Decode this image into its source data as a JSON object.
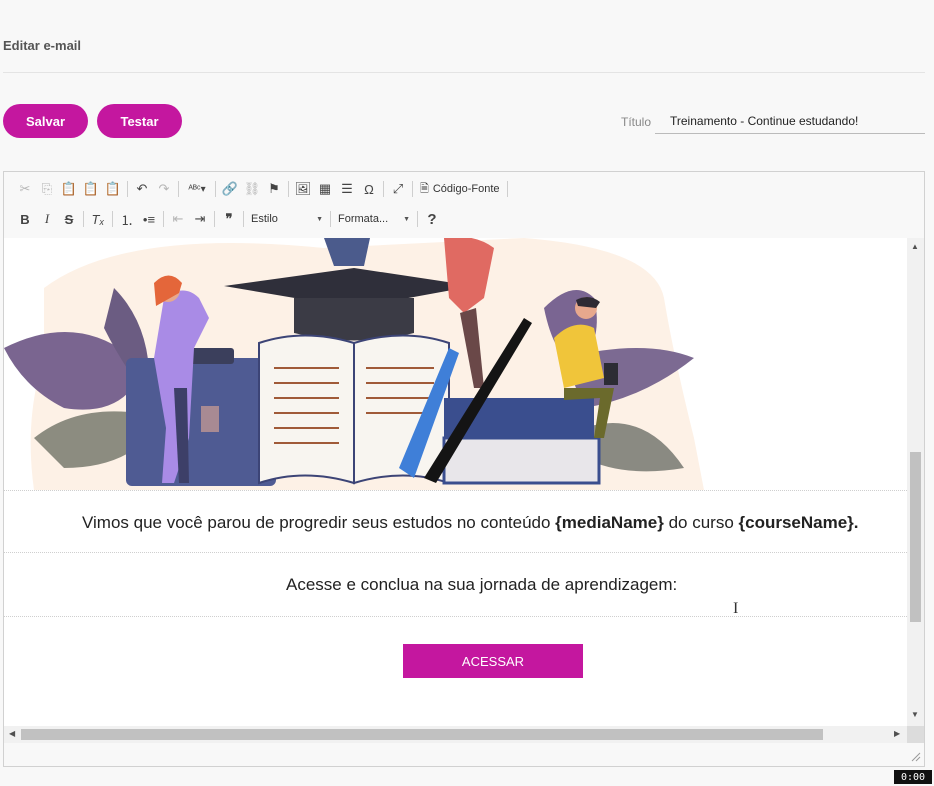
{
  "page": {
    "header": "Editar e-mail"
  },
  "actions": {
    "save_label": "Salvar",
    "test_label": "Testar"
  },
  "title_field": {
    "label": "Título",
    "value": "Treinamento - Continue estudando!"
  },
  "toolbar": {
    "row1": [
      "cut-icon",
      "copy-icon",
      "paste-icon",
      "paste-text-icon",
      "paste-word-icon",
      "undo-icon",
      "redo-icon",
      "spellcheck-icon",
      "link-icon",
      "unlink-icon",
      "anchor-icon",
      "image-icon",
      "table-icon",
      "horizontal-rule-icon",
      "special-char-icon",
      "maximize-icon",
      "source-icon"
    ],
    "source_label": "Código-Fonte",
    "style_combo": "Estilo",
    "format_combo": "Formata...",
    "help": "?"
  },
  "content": {
    "message_prefix": "Vimos que você parou de progredir seus estudos no conteúdo ",
    "media_var": "{mediaName}",
    "message_mid": " do curso ",
    "course_var": "{courseName}.",
    "cta_text": "Acesse e conclua na sua jornada de aprendizagem:",
    "button_label": "ACESSAR"
  },
  "colors": {
    "accent": "#c4179f"
  },
  "timer": "0:00"
}
